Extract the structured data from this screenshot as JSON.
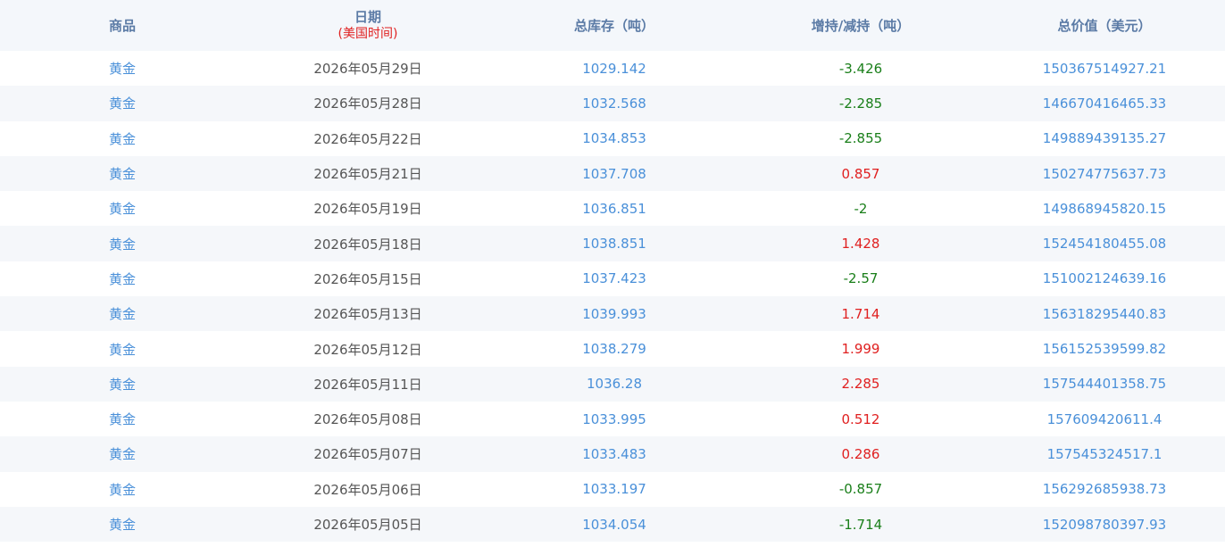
{
  "header": {
    "col1": "商品",
    "col2": "日期",
    "col2_sub": "(美国时间)",
    "col3": "总库存（吨）",
    "col4": "增持/减持（吨）",
    "col5": "总价值（美元）"
  },
  "colors": {
    "increase": "#e02020",
    "decrease": "#1a7f1a",
    "link": "#4a90d9"
  },
  "rows": [
    {
      "name": "黄金",
      "date": "2026年05月29日",
      "stock": "1029.142",
      "change": "-3.426",
      "value": "150367514927.21"
    },
    {
      "name": "黄金",
      "date": "2026年05月28日",
      "stock": "1032.568",
      "change": "-2.285",
      "value": "146670416465.33"
    },
    {
      "name": "黄金",
      "date": "2026年05月22日",
      "stock": "1034.853",
      "change": "-2.855",
      "value": "149889439135.27"
    },
    {
      "name": "黄金",
      "date": "2026年05月21日",
      "stock": "1037.708",
      "change": "0.857",
      "value": "150274775637.73"
    },
    {
      "name": "黄金",
      "date": "2026年05月19日",
      "stock": "1036.851",
      "change": "-2",
      "value": "149868945820.15"
    },
    {
      "name": "黄金",
      "date": "2026年05月18日",
      "stock": "1038.851",
      "change": "1.428",
      "value": "152454180455.08"
    },
    {
      "name": "黄金",
      "date": "2026年05月15日",
      "stock": "1037.423",
      "change": "-2.57",
      "value": "151002124639.16"
    },
    {
      "name": "黄金",
      "date": "2026年05月13日",
      "stock": "1039.993",
      "change": "1.714",
      "value": "156318295440.83"
    },
    {
      "name": "黄金",
      "date": "2026年05月12日",
      "stock": "1038.279",
      "change": "1.999",
      "value": "156152539599.82"
    },
    {
      "name": "黄金",
      "date": "2026年05月11日",
      "stock": "1036.28",
      "change": "2.285",
      "value": "157544401358.75"
    },
    {
      "name": "黄金",
      "date": "2026年05月08日",
      "stock": "1033.995",
      "change": "0.512",
      "value": "157609420611.4"
    },
    {
      "name": "黄金",
      "date": "2026年05月07日",
      "stock": "1033.483",
      "change": "0.286",
      "value": "157545324517.1"
    },
    {
      "name": "黄金",
      "date": "2026年05月06日",
      "stock": "1033.197",
      "change": "-0.857",
      "value": "156292685938.73"
    },
    {
      "name": "黄金",
      "date": "2026年05月05日",
      "stock": "1034.054",
      "change": "-1.714",
      "value": "152098780397.93"
    }
  ]
}
